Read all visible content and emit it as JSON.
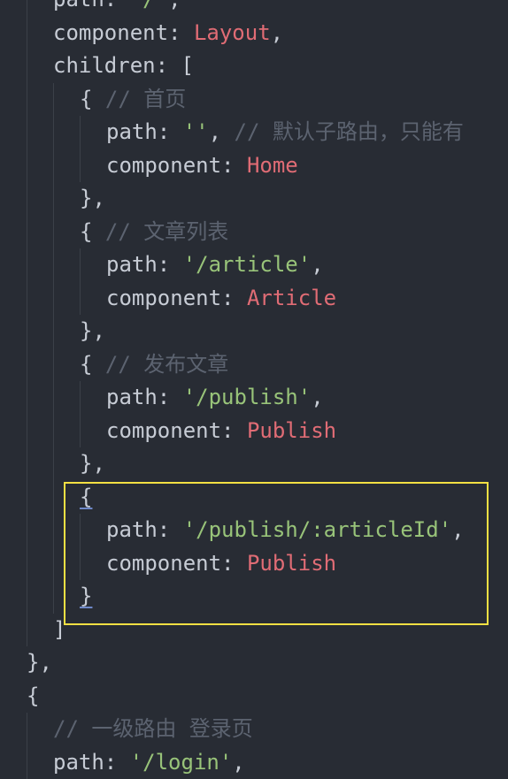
{
  "code": {
    "lines": [
      {
        "segs": [
          {
            "t": "path",
            "c": "t-key"
          },
          {
            "t": ": ",
            "c": "t-punc"
          },
          {
            "t": "'/'",
            "c": "t-str"
          },
          {
            "t": ",",
            "c": "t-punc"
          }
        ]
      },
      {
        "segs": [
          {
            "t": "component",
            "c": "t-key"
          },
          {
            "t": ": ",
            "c": "t-punc"
          },
          {
            "t": "Layout",
            "c": "t-comp"
          },
          {
            "t": ",",
            "c": "t-punc"
          }
        ]
      },
      {
        "segs": [
          {
            "t": "children",
            "c": "t-key"
          },
          {
            "t": ": [",
            "c": "t-punc"
          }
        ]
      },
      {
        "segs": [
          {
            "t": "{ ",
            "c": "t-punc"
          },
          {
            "t": "// 首页",
            "c": "t-comment"
          }
        ]
      },
      {
        "segs": [
          {
            "t": "path",
            "c": "t-key"
          },
          {
            "t": ": ",
            "c": "t-punc"
          },
          {
            "t": "''",
            "c": "t-str"
          },
          {
            "t": ", ",
            "c": "t-punc"
          },
          {
            "t": "// 默认子路由，只能有",
            "c": "t-comment"
          }
        ]
      },
      {
        "segs": [
          {
            "t": "component",
            "c": "t-key"
          },
          {
            "t": ": ",
            "c": "t-punc"
          },
          {
            "t": "Home",
            "c": "t-comp"
          }
        ]
      },
      {
        "segs": [
          {
            "t": "},",
            "c": "t-punc"
          }
        ]
      },
      {
        "segs": [
          {
            "t": "{ ",
            "c": "t-punc"
          },
          {
            "t": "// 文章列表",
            "c": "t-comment"
          }
        ]
      },
      {
        "segs": [
          {
            "t": "path",
            "c": "t-key"
          },
          {
            "t": ": ",
            "c": "t-punc"
          },
          {
            "t": "'/article'",
            "c": "t-str"
          },
          {
            "t": ",",
            "c": "t-punc"
          }
        ]
      },
      {
        "segs": [
          {
            "t": "component",
            "c": "t-key"
          },
          {
            "t": ": ",
            "c": "t-punc"
          },
          {
            "t": "Article",
            "c": "t-comp"
          }
        ]
      },
      {
        "segs": [
          {
            "t": "},",
            "c": "t-punc"
          }
        ]
      },
      {
        "segs": [
          {
            "t": "{ ",
            "c": "t-punc"
          },
          {
            "t": "// 发布文章",
            "c": "t-comment"
          }
        ]
      },
      {
        "segs": [
          {
            "t": "path",
            "c": "t-key"
          },
          {
            "t": ": ",
            "c": "t-punc"
          },
          {
            "t": "'/publish'",
            "c": "t-str"
          },
          {
            "t": ",",
            "c": "t-punc"
          }
        ]
      },
      {
        "segs": [
          {
            "t": "component",
            "c": "t-key"
          },
          {
            "t": ": ",
            "c": "t-punc"
          },
          {
            "t": "Publish",
            "c": "t-comp"
          }
        ]
      },
      {
        "segs": [
          {
            "t": "},",
            "c": "t-punc"
          }
        ]
      },
      {
        "segs": [
          {
            "t": "{",
            "c": "t-punc t-brace-hl"
          }
        ]
      },
      {
        "segs": [
          {
            "t": "path",
            "c": "t-key"
          },
          {
            "t": ": ",
            "c": "t-punc"
          },
          {
            "t": "'/publish/:articleId'",
            "c": "t-str"
          },
          {
            "t": ",",
            "c": "t-punc"
          }
        ]
      },
      {
        "segs": [
          {
            "t": "component",
            "c": "t-key"
          },
          {
            "t": ": ",
            "c": "t-punc"
          },
          {
            "t": "Publish",
            "c": "t-comp"
          }
        ]
      },
      {
        "segs": [
          {
            "t": "}",
            "c": "t-punc t-brace-hl"
          }
        ]
      },
      {
        "segs": [
          {
            "t": "]",
            "c": "t-punc"
          }
        ]
      },
      {
        "segs": [
          {
            "t": "},",
            "c": "t-punc"
          }
        ]
      },
      {
        "segs": [
          {
            "t": "{",
            "c": "t-punc"
          }
        ]
      },
      {
        "segs": [
          {
            "t": "// 一级路由 登录页",
            "c": "t-comment"
          }
        ]
      },
      {
        "segs": [
          {
            "t": "path",
            "c": "t-key"
          },
          {
            "t": ": ",
            "c": "t-punc"
          },
          {
            "t": "'/login'",
            "c": "t-str"
          },
          {
            "t": ",",
            "c": "t-punc"
          }
        ]
      }
    ]
  }
}
